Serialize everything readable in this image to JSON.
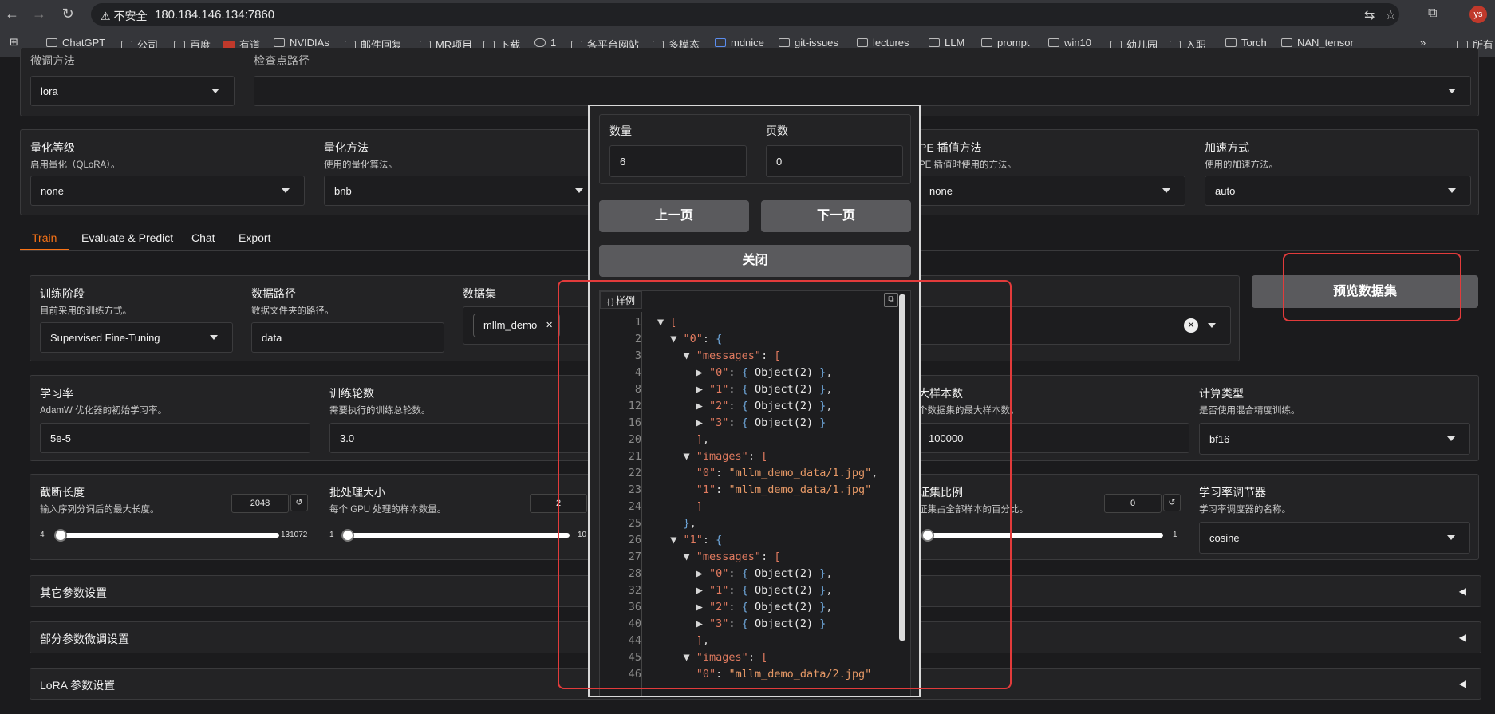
{
  "browser": {
    "insecure_label": "不安全",
    "url": "180.184.146.134:7860",
    "avatar": "ys",
    "bookmarks": [
      "ChatGPT",
      "公司",
      "百度",
      "有道",
      "NVIDIAs",
      "邮件回复",
      "MR项目",
      "下载",
      "1",
      "各平台网站",
      "多模态",
      "mdnice",
      "git-issues",
      "lectures",
      "LLM",
      "prompt",
      "win10",
      "幼儿园",
      "入职",
      "Torch",
      "NAN_tensor",
      "»",
      "所有"
    ]
  },
  "top_row": {
    "finetune_label": "微调方法",
    "finetune_value": "lora",
    "checkpoint_label": "检查点路径"
  },
  "quant": {
    "level_label": "量化等级",
    "level_sub": "启用量化（QLoRA）。",
    "level_value": "none",
    "method_label": "量化方法",
    "method_sub": "使用的量化算法。",
    "method_value": "bnb",
    "rope_label": "PE 插值方法",
    "rope_sub": "PE 插值时使用的方法。",
    "rope_value": "none",
    "accel_label": "加速方式",
    "accel_sub": "使用的加速方法。",
    "accel_value": "auto"
  },
  "tabs": [
    "Train",
    "Evaluate & Predict",
    "Chat",
    "Export"
  ],
  "train": {
    "stage_label": "训练阶段",
    "stage_sub": "目前采用的训练方式。",
    "stage_value": "Supervised Fine-Tuning",
    "datapath_label": "数据路径",
    "datapath_sub": "数据文件夹的路径。",
    "datapath_value": "data",
    "dataset_label": "数据集",
    "dataset_chip": "mllm_demo",
    "preview_button": "预览数据集"
  },
  "params": {
    "lr_label": "学习率",
    "lr_sub": "AdamW 优化器的初始学习率。",
    "lr_value": "5e-5",
    "epochs_label": "训练轮数",
    "epochs_sub": "需要执行的训练总轮数。",
    "epochs_value": "3.0",
    "maxsamples_label": "大样本数",
    "maxsamples_sub": "个数据集的最大样本数。",
    "maxsamples_value": "100000",
    "compute_label": "计算类型",
    "compute_sub": "是否使用混合精度训练。",
    "compute_value": "bf16",
    "cutoff_label": "截断长度",
    "cutoff_sub": "输入序列分词后的最大长度。",
    "cutoff_value": "2048",
    "cutoff_min": "4",
    "cutoff_max": "131072",
    "batch_label": "批处理大小",
    "batch_sub": "每个 GPU 处理的样本数量。",
    "batch_value": "2",
    "batch_min": "1",
    "batch_max": "10",
    "val_label": "证集比例",
    "val_sub": "证集占全部样本的百分比。",
    "val_value": "0",
    "val_max": "1",
    "sched_label": "学习率调节器",
    "sched_sub": "学习率调度器的名称。",
    "sched_value": "cosine"
  },
  "sections": [
    "其它参数设置",
    "部分参数微调设置",
    "LoRA 参数设置"
  ],
  "modal": {
    "count_label": "数量",
    "count_value": "6",
    "page_label": "页数",
    "page_value": "0",
    "prev_button": "上一页",
    "next_button": "下一页",
    "close_button": "关闭",
    "json_tag": "样例",
    "json_lines": [
      {
        "n": "1",
        "t": "▼ ["
      },
      {
        "n": "2",
        "t": "  ▼ \"0\": {"
      },
      {
        "n": "3",
        "t": "    ▼ \"messages\": ["
      },
      {
        "n": "4",
        "t": "      ▶ \"0\": { Object(2) },"
      },
      {
        "n": "8",
        "t": "      ▶ \"1\": { Object(2) },"
      },
      {
        "n": "12",
        "t": "      ▶ \"2\": { Object(2) },"
      },
      {
        "n": "16",
        "t": "      ▶ \"3\": { Object(2) }"
      },
      {
        "n": "20",
        "t": "      ],"
      },
      {
        "n": "21",
        "t": "    ▼ \"images\": ["
      },
      {
        "n": "22",
        "t": "      \"0\": \"mllm_demo_data/1.jpg\","
      },
      {
        "n": "23",
        "t": "      \"1\": \"mllm_demo_data/1.jpg\""
      },
      {
        "n": "24",
        "t": "      ]"
      },
      {
        "n": "25",
        "t": "    },"
      },
      {
        "n": "26",
        "t": "  ▼ \"1\": {"
      },
      {
        "n": "27",
        "t": "    ▼ \"messages\": ["
      },
      {
        "n": "28",
        "t": "      ▶ \"0\": { Object(2) },"
      },
      {
        "n": "32",
        "t": "      ▶ \"1\": { Object(2) },"
      },
      {
        "n": "36",
        "t": "      ▶ \"2\": { Object(2) },"
      },
      {
        "n": "40",
        "t": "      ▶ \"3\": { Object(2) }"
      },
      {
        "n": "44",
        "t": "      ],"
      },
      {
        "n": "45",
        "t": "    ▼ \"images\": ["
      },
      {
        "n": "46",
        "t": "      \"0\": \"mllm_demo_data/2.jpg\""
      }
    ]
  },
  "colors": {
    "accent": "#f97316",
    "highlight": "#e23b3b"
  }
}
